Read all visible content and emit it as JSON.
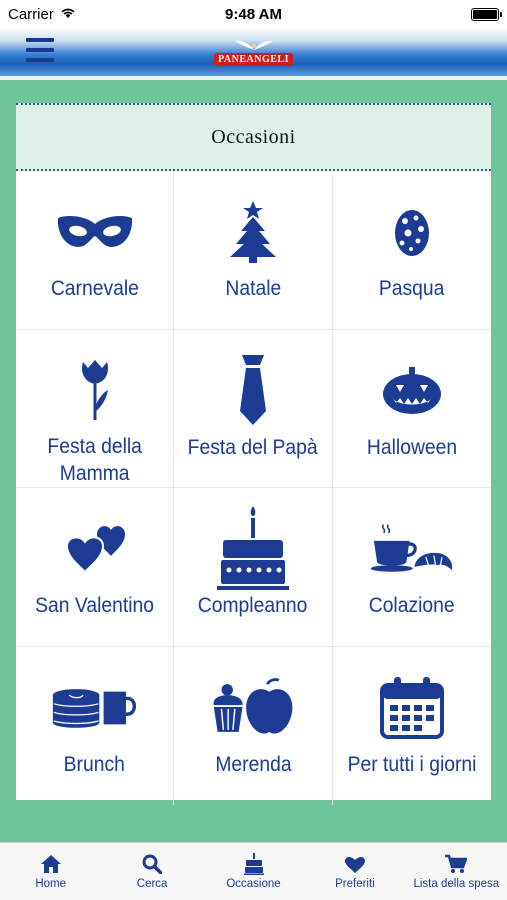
{
  "status_bar": {
    "carrier": "Carrier",
    "time": "9:48 AM"
  },
  "header": {
    "logo_text": "PANEANGELI",
    "menu_icon": "hamburger-menu-icon"
  },
  "card": {
    "title": "Occasioni"
  },
  "occasions": [
    {
      "label": "Carnevale",
      "icon": "mask-icon"
    },
    {
      "label": "Natale",
      "icon": "christmas-tree-icon"
    },
    {
      "label": "Pasqua",
      "icon": "easter-egg-icon"
    },
    {
      "label": "Festa della Mamma",
      "icon": "tulip-icon"
    },
    {
      "label": "Festa del Papà",
      "icon": "necktie-icon"
    },
    {
      "label": "Halloween",
      "icon": "pumpkin-icon"
    },
    {
      "label": "San Valentino",
      "icon": "hearts-icon"
    },
    {
      "label": "Compleanno",
      "icon": "birthday-cake-icon"
    },
    {
      "label": "Colazione",
      "icon": "coffee-croissant-icon"
    },
    {
      "label": "Brunch",
      "icon": "pancakes-mug-icon"
    },
    {
      "label": "Merenda",
      "icon": "cupcake-apple-icon"
    },
    {
      "label": "Per tutti i giorni",
      "icon": "calendar-icon"
    }
  ],
  "tab_bar": [
    {
      "label": "Home",
      "icon": "home-icon"
    },
    {
      "label": "Cerca",
      "icon": "search-icon"
    },
    {
      "label": "Occasione",
      "icon": "cake-icon"
    },
    {
      "label": "Preferiti",
      "icon": "heart-icon"
    },
    {
      "label": "Lista della spesa",
      "icon": "cart-icon"
    }
  ],
  "colors": {
    "accent": "#1c3c94",
    "background": "#6dc59a",
    "card_header": "#dff2e7",
    "brand_red": "#d21d1d"
  }
}
